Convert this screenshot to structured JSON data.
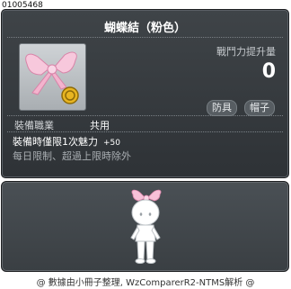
{
  "item": {
    "id": "01005468",
    "name": "蝴蝶結（粉色）",
    "stat_label": "戰鬥力提升量",
    "stat_value": "0",
    "tags": [
      "防具",
      "帽子"
    ],
    "job_label": "裝備職業",
    "job_value": "共用",
    "effect_text": "裝備時僅限1次魅力",
    "effect_value": "+50",
    "limit_text": "每日限制、超過上限時除外"
  },
  "footer": {
    "credit": "@ 數據由小冊子整理, WzComparerR2-NTMS解析 @"
  }
}
